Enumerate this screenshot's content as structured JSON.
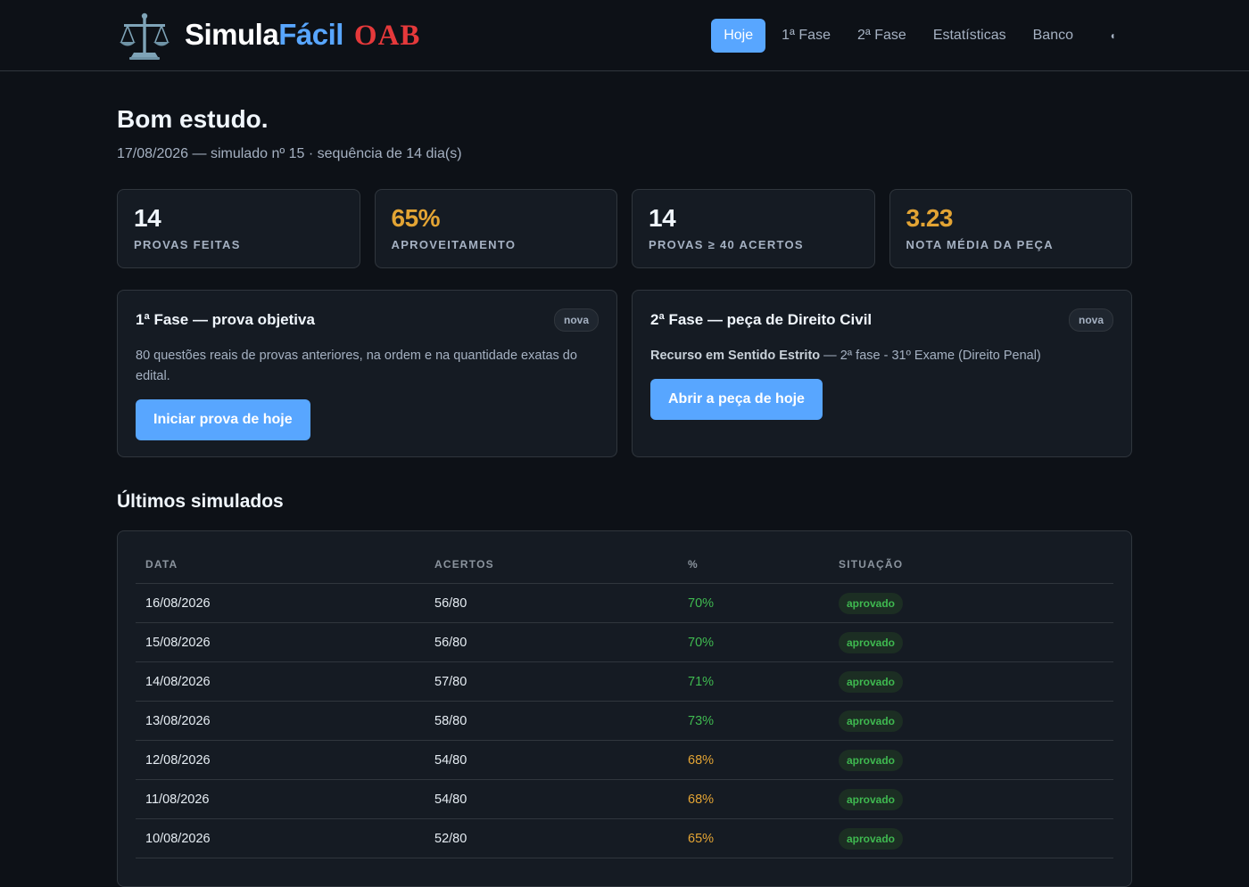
{
  "brand": {
    "part1": "Simula",
    "part2": "Fácil",
    "part3": "OAB"
  },
  "nav": {
    "items": [
      "Hoje",
      "1ª Fase",
      "2ª Fase",
      "Estatísticas",
      "Banco"
    ],
    "toggle_icon": "◖"
  },
  "page": {
    "title": "Bom estudo.",
    "subtitle": "17/08/2026 — simulado nº 15 · sequência de 14 dia(s)"
  },
  "stats": [
    {
      "value": "14",
      "label": "Provas feitas"
    },
    {
      "value": "65%",
      "label": "Aproveitamento"
    },
    {
      "value": "14",
      "label": "Provas ≥ 40 acertos"
    },
    {
      "value": "3.23",
      "label": "Nota média da peça"
    }
  ],
  "cards": {
    "fase1": {
      "title": "1ª Fase — prova objetiva",
      "badge": "nova",
      "text": "80 questões reais de provas anteriores, na ordem e na quantidade exatas do edital.",
      "button": "Iniciar prova de hoje"
    },
    "fase2": {
      "title": "2ª Fase — peça de Direito Civil",
      "badge": "nova",
      "text_strong": "Recurso em Sentido Estrito",
      "text_rest": " — 2ª fase - 31º Exame (Direito Penal)",
      "button": "Abrir a peça de hoje"
    }
  },
  "history": {
    "title": "Últimos simulados",
    "columns": [
      "Data",
      "Acertos",
      "%",
      "Situação"
    ],
    "rows": [
      {
        "date": "16/08/2026",
        "acertos": "56/80",
        "pct": "70%",
        "status": "aprovado"
      },
      {
        "date": "15/08/2026",
        "acertos": "56/80",
        "pct": "70%",
        "status": "aprovado"
      },
      {
        "date": "14/08/2026",
        "acertos": "57/80",
        "pct": "71%",
        "status": "aprovado"
      },
      {
        "date": "13/08/2026",
        "acertos": "58/80",
        "pct": "73%",
        "status": "aprovado"
      },
      {
        "date": "12/08/2026",
        "acertos": "54/80",
        "pct": "68%",
        "status": "aprovado"
      },
      {
        "date": "11/08/2026",
        "acertos": "54/80",
        "pct": "68%",
        "status": "aprovado"
      },
      {
        "date": "10/08/2026",
        "acertos": "52/80",
        "pct": "65%",
        "status": "aprovado"
      }
    ]
  },
  "colors": {
    "accent": "#58a6ff",
    "warn": "#e3a434",
    "good": "#3fb950",
    "brand_red": "#e5393b",
    "background": "#0d1117",
    "card": "#151b23"
  },
  "icons": {
    "logo": "scales-of-justice-icon"
  }
}
